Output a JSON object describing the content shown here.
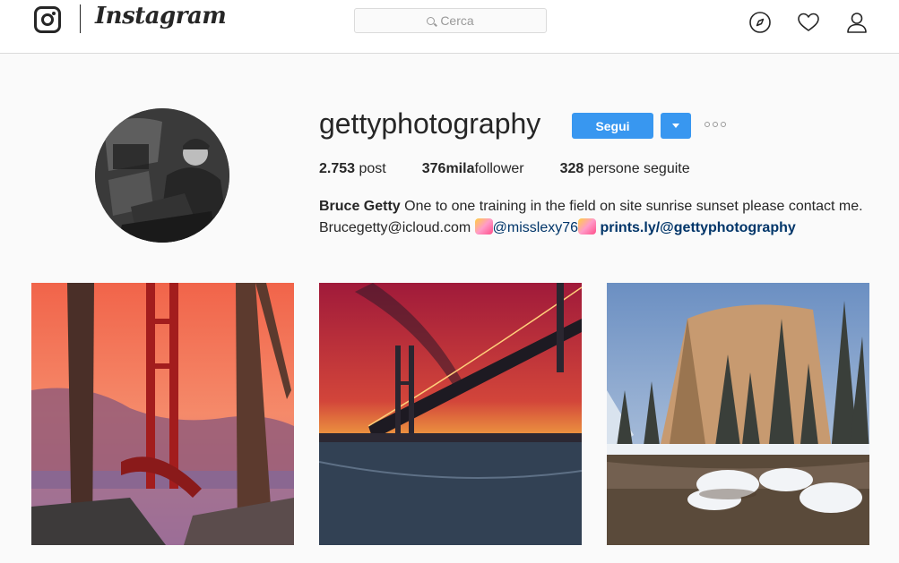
{
  "nav": {
    "brand": "Instagram",
    "search_placeholder": "Cerca",
    "icons": [
      "instagram-glyph-icon",
      "compass-icon",
      "heart-icon",
      "user-icon"
    ]
  },
  "profile": {
    "username": "gettyphotography",
    "follow_label": "Segui",
    "stats": {
      "posts_count": "2.753",
      "posts_label": "post",
      "followers_count": "376mila",
      "followers_label": "follower",
      "following_count": "328",
      "following_label": "persone seguite"
    },
    "bio": {
      "full_name": "Bruce Getty",
      "text": "One to one training in the field on site sunrise sunset please contact me. Brucegetty@icloud.com",
      "mention": "@misslexy76",
      "link": "prints.ly/@gettyphotography"
    }
  },
  "colors": {
    "accent": "#3897f0",
    "link": "#003569",
    "background": "#fafafa",
    "text": "#262626"
  },
  "photos": [
    {
      "subject": "golden-gate-bridge-sunset"
    },
    {
      "subject": "bay-bridge-night"
    },
    {
      "subject": "yosemite-winter-river"
    }
  ]
}
